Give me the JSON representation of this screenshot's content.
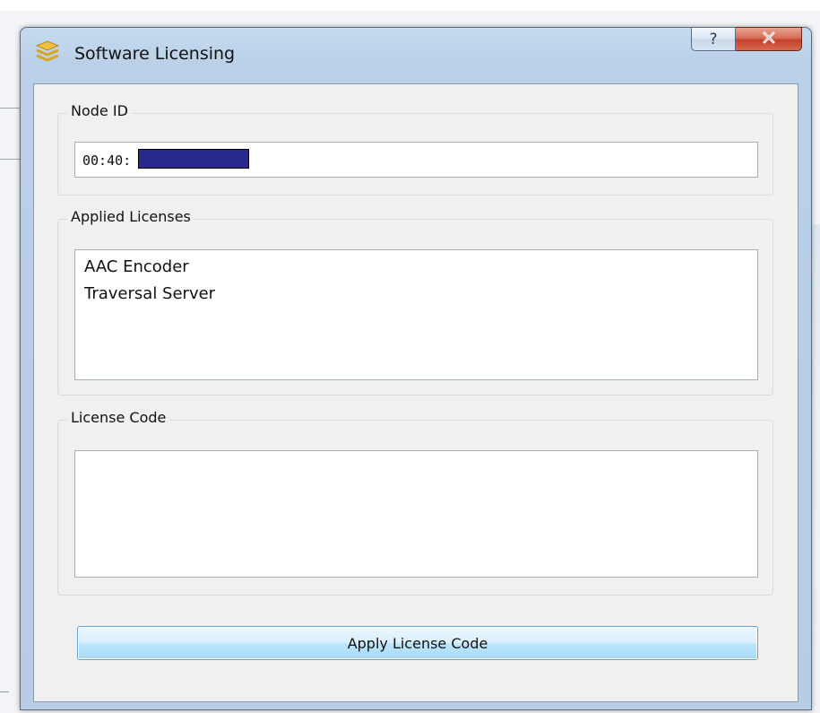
{
  "window": {
    "title": "Software Licensing",
    "help_label": "?",
    "close_label": "✕"
  },
  "node_id": {
    "group_label": "Node ID",
    "value": "00:40:"
  },
  "applied_licenses": {
    "group_label": "Applied Licenses",
    "items": [
      "AAC Encoder",
      "Traversal Server"
    ]
  },
  "license_code": {
    "group_label": "License Code",
    "value": ""
  },
  "apply_button": {
    "label": "Apply License Code"
  },
  "colors": {
    "titlebar": "#c5dbef",
    "client": "#f0f0f0",
    "close_button": "#c4402a",
    "redaction": "#28288a",
    "button_accent": "#bee6fd"
  }
}
